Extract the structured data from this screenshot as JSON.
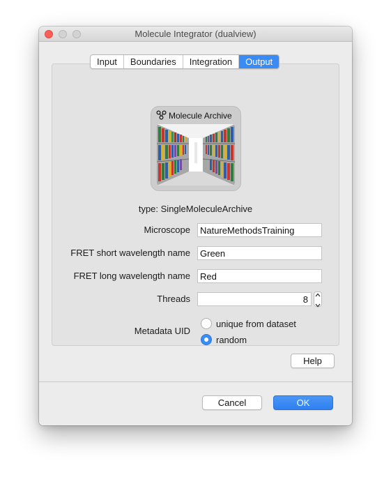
{
  "window": {
    "title": "Molecule Integrator (dualview)"
  },
  "tabs": [
    {
      "label": "Input",
      "active": false
    },
    {
      "label": "Boundaries",
      "active": false
    },
    {
      "label": "Integration",
      "active": false
    },
    {
      "label": "Output",
      "active": true
    }
  ],
  "archive": {
    "header": "Molecule Archive",
    "icon": "molecule-icon",
    "image": "archive-shelves-image"
  },
  "type_line": "type: SingleMoleculeArchive",
  "form": {
    "microscope": {
      "label": "Microscope",
      "value": "NatureMethodsTraining"
    },
    "fret_short": {
      "label": "FRET short wavelength name",
      "value": "Green"
    },
    "fret_long": {
      "label": "FRET long wavelength name",
      "value": "Red"
    },
    "threads": {
      "label": "Threads",
      "value": "8"
    },
    "metadata_uid": {
      "label": "Metadata UID",
      "options": [
        {
          "label": "unique from dataset",
          "selected": false
        },
        {
          "label": "random",
          "selected": true
        }
      ]
    }
  },
  "buttons": {
    "help": "Help",
    "cancel": "Cancel",
    "ok": "OK"
  },
  "colors": {
    "accent": "#3a8bf6",
    "close": "#fc5f57",
    "window_bg": "#ececec"
  }
}
